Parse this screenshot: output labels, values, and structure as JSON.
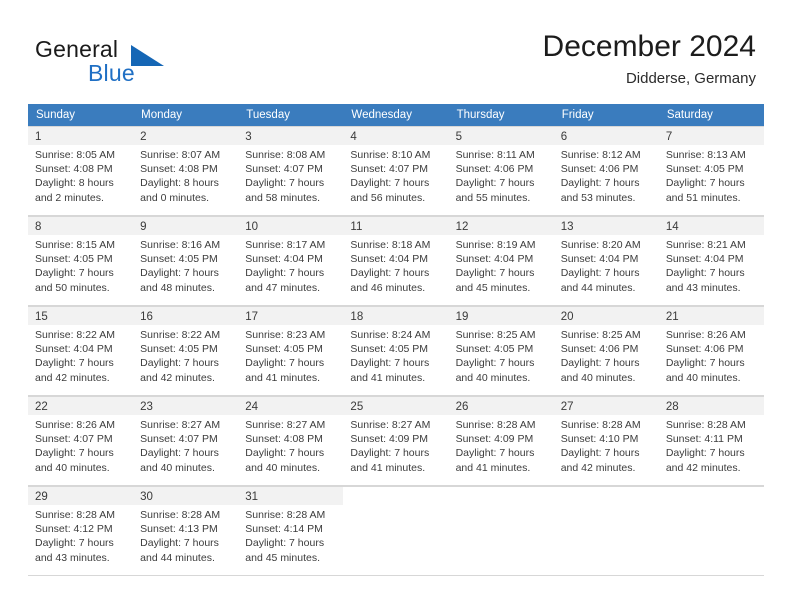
{
  "brand": {
    "general": "General",
    "blue": "Blue",
    "logo_icon": "triangle-logo-icon"
  },
  "header": {
    "title": "December 2024",
    "location": "Didderse, Germany"
  },
  "calendar": {
    "weekday_headers": [
      "Sunday",
      "Monday",
      "Tuesday",
      "Wednesday",
      "Thursday",
      "Friday",
      "Saturday"
    ],
    "accent_color": "#3a7cbe",
    "daynum_band_color": "#f2f2f2",
    "weeks": [
      [
        {
          "day": "1",
          "sunrise": "Sunrise: 8:05 AM",
          "sunset": "Sunset: 4:08 PM",
          "daylight1": "Daylight: 8 hours",
          "daylight2": "and 2 minutes."
        },
        {
          "day": "2",
          "sunrise": "Sunrise: 8:07 AM",
          "sunset": "Sunset: 4:08 PM",
          "daylight1": "Daylight: 8 hours",
          "daylight2": "and 0 minutes."
        },
        {
          "day": "3",
          "sunrise": "Sunrise: 8:08 AM",
          "sunset": "Sunset: 4:07 PM",
          "daylight1": "Daylight: 7 hours",
          "daylight2": "and 58 minutes."
        },
        {
          "day": "4",
          "sunrise": "Sunrise: 8:10 AM",
          "sunset": "Sunset: 4:07 PM",
          "daylight1": "Daylight: 7 hours",
          "daylight2": "and 56 minutes."
        },
        {
          "day": "5",
          "sunrise": "Sunrise: 8:11 AM",
          "sunset": "Sunset: 4:06 PM",
          "daylight1": "Daylight: 7 hours",
          "daylight2": "and 55 minutes."
        },
        {
          "day": "6",
          "sunrise": "Sunrise: 8:12 AM",
          "sunset": "Sunset: 4:06 PM",
          "daylight1": "Daylight: 7 hours",
          "daylight2": "and 53 minutes."
        },
        {
          "day": "7",
          "sunrise": "Sunrise: 8:13 AM",
          "sunset": "Sunset: 4:05 PM",
          "daylight1": "Daylight: 7 hours",
          "daylight2": "and 51 minutes."
        }
      ],
      [
        {
          "day": "8",
          "sunrise": "Sunrise: 8:15 AM",
          "sunset": "Sunset: 4:05 PM",
          "daylight1": "Daylight: 7 hours",
          "daylight2": "and 50 minutes."
        },
        {
          "day": "9",
          "sunrise": "Sunrise: 8:16 AM",
          "sunset": "Sunset: 4:05 PM",
          "daylight1": "Daylight: 7 hours",
          "daylight2": "and 48 minutes."
        },
        {
          "day": "10",
          "sunrise": "Sunrise: 8:17 AM",
          "sunset": "Sunset: 4:04 PM",
          "daylight1": "Daylight: 7 hours",
          "daylight2": "and 47 minutes."
        },
        {
          "day": "11",
          "sunrise": "Sunrise: 8:18 AM",
          "sunset": "Sunset: 4:04 PM",
          "daylight1": "Daylight: 7 hours",
          "daylight2": "and 46 minutes."
        },
        {
          "day": "12",
          "sunrise": "Sunrise: 8:19 AM",
          "sunset": "Sunset: 4:04 PM",
          "daylight1": "Daylight: 7 hours",
          "daylight2": "and 45 minutes."
        },
        {
          "day": "13",
          "sunrise": "Sunrise: 8:20 AM",
          "sunset": "Sunset: 4:04 PM",
          "daylight1": "Daylight: 7 hours",
          "daylight2": "and 44 minutes."
        },
        {
          "day": "14",
          "sunrise": "Sunrise: 8:21 AM",
          "sunset": "Sunset: 4:04 PM",
          "daylight1": "Daylight: 7 hours",
          "daylight2": "and 43 minutes."
        }
      ],
      [
        {
          "day": "15",
          "sunrise": "Sunrise: 8:22 AM",
          "sunset": "Sunset: 4:04 PM",
          "daylight1": "Daylight: 7 hours",
          "daylight2": "and 42 minutes."
        },
        {
          "day": "16",
          "sunrise": "Sunrise: 8:22 AM",
          "sunset": "Sunset: 4:05 PM",
          "daylight1": "Daylight: 7 hours",
          "daylight2": "and 42 minutes."
        },
        {
          "day": "17",
          "sunrise": "Sunrise: 8:23 AM",
          "sunset": "Sunset: 4:05 PM",
          "daylight1": "Daylight: 7 hours",
          "daylight2": "and 41 minutes."
        },
        {
          "day": "18",
          "sunrise": "Sunrise: 8:24 AM",
          "sunset": "Sunset: 4:05 PM",
          "daylight1": "Daylight: 7 hours",
          "daylight2": "and 41 minutes."
        },
        {
          "day": "19",
          "sunrise": "Sunrise: 8:25 AM",
          "sunset": "Sunset: 4:05 PM",
          "daylight1": "Daylight: 7 hours",
          "daylight2": "and 40 minutes."
        },
        {
          "day": "20",
          "sunrise": "Sunrise: 8:25 AM",
          "sunset": "Sunset: 4:06 PM",
          "daylight1": "Daylight: 7 hours",
          "daylight2": "and 40 minutes."
        },
        {
          "day": "21",
          "sunrise": "Sunrise: 8:26 AM",
          "sunset": "Sunset: 4:06 PM",
          "daylight1": "Daylight: 7 hours",
          "daylight2": "and 40 minutes."
        }
      ],
      [
        {
          "day": "22",
          "sunrise": "Sunrise: 8:26 AM",
          "sunset": "Sunset: 4:07 PM",
          "daylight1": "Daylight: 7 hours",
          "daylight2": "and 40 minutes."
        },
        {
          "day": "23",
          "sunrise": "Sunrise: 8:27 AM",
          "sunset": "Sunset: 4:07 PM",
          "daylight1": "Daylight: 7 hours",
          "daylight2": "and 40 minutes."
        },
        {
          "day": "24",
          "sunrise": "Sunrise: 8:27 AM",
          "sunset": "Sunset: 4:08 PM",
          "daylight1": "Daylight: 7 hours",
          "daylight2": "and 40 minutes."
        },
        {
          "day": "25",
          "sunrise": "Sunrise: 8:27 AM",
          "sunset": "Sunset: 4:09 PM",
          "daylight1": "Daylight: 7 hours",
          "daylight2": "and 41 minutes."
        },
        {
          "day": "26",
          "sunrise": "Sunrise: 8:28 AM",
          "sunset": "Sunset: 4:09 PM",
          "daylight1": "Daylight: 7 hours",
          "daylight2": "and 41 minutes."
        },
        {
          "day": "27",
          "sunrise": "Sunrise: 8:28 AM",
          "sunset": "Sunset: 4:10 PM",
          "daylight1": "Daylight: 7 hours",
          "daylight2": "and 42 minutes."
        },
        {
          "day": "28",
          "sunrise": "Sunrise: 8:28 AM",
          "sunset": "Sunset: 4:11 PM",
          "daylight1": "Daylight: 7 hours",
          "daylight2": "and 42 minutes."
        }
      ],
      [
        {
          "day": "29",
          "sunrise": "Sunrise: 8:28 AM",
          "sunset": "Sunset: 4:12 PM",
          "daylight1": "Daylight: 7 hours",
          "daylight2": "and 43 minutes."
        },
        {
          "day": "30",
          "sunrise": "Sunrise: 8:28 AM",
          "sunset": "Sunset: 4:13 PM",
          "daylight1": "Daylight: 7 hours",
          "daylight2": "and 44 minutes."
        },
        {
          "day": "31",
          "sunrise": "Sunrise: 8:28 AM",
          "sunset": "Sunset: 4:14 PM",
          "daylight1": "Daylight: 7 hours",
          "daylight2": "and 45 minutes."
        },
        null,
        null,
        null,
        null
      ]
    ]
  }
}
